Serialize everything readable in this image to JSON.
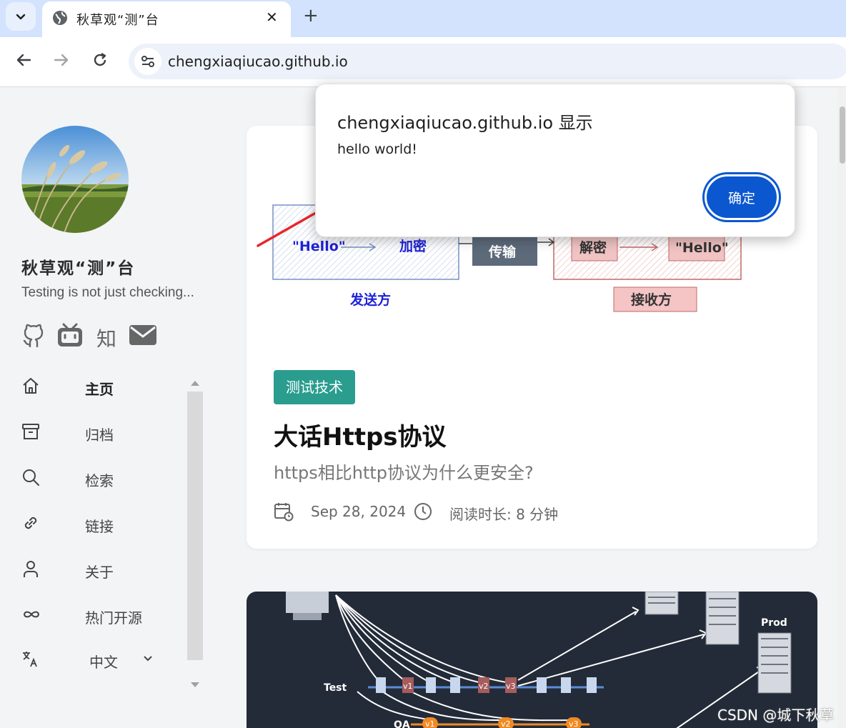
{
  "browser": {
    "tab_title": "秋草观“测”台",
    "close_glyph": "✕",
    "newtab_glyph": "+",
    "url": "chengxiaqiucao.github.io"
  },
  "dialog": {
    "title": "chengxiaqiucao.github.io 显示",
    "message": "hello world!",
    "ok_label": "确定"
  },
  "sidebar": {
    "site_title": "秋草观“测”台",
    "subtitle": "Testing is not just checking...",
    "zhihu_label": "知",
    "items": [
      {
        "label": "主页",
        "icon": "home-icon"
      },
      {
        "label": "归档",
        "icon": "archive-icon"
      },
      {
        "label": "检索",
        "icon": "search-icon"
      },
      {
        "label": "链接",
        "icon": "link-icon"
      },
      {
        "label": "关于",
        "icon": "user-icon"
      },
      {
        "label": "热门开源",
        "icon": "infinity-icon"
      }
    ],
    "language": "中文"
  },
  "post": {
    "diagram": {
      "hello_left": "\"Hello\"",
      "encrypt": "加密",
      "transfer": "传输",
      "decrypt": "解密",
      "hello_right": "\"Hello\"",
      "sender": "发送方",
      "receiver": "接收方"
    },
    "tag": "测试技术",
    "title": "大话Https协议",
    "description": "https相比http协议为什么更安全?",
    "date": "Sep 28, 2024",
    "reading_time": "阅读时长: 8 分钟"
  },
  "post2": {
    "lane_test": "Test",
    "lane_qa": "QA",
    "prod": "Prod",
    "v1": "v1",
    "v2": "v2",
    "v3": "v3"
  },
  "watermark": "CSDN @城下秋草"
}
